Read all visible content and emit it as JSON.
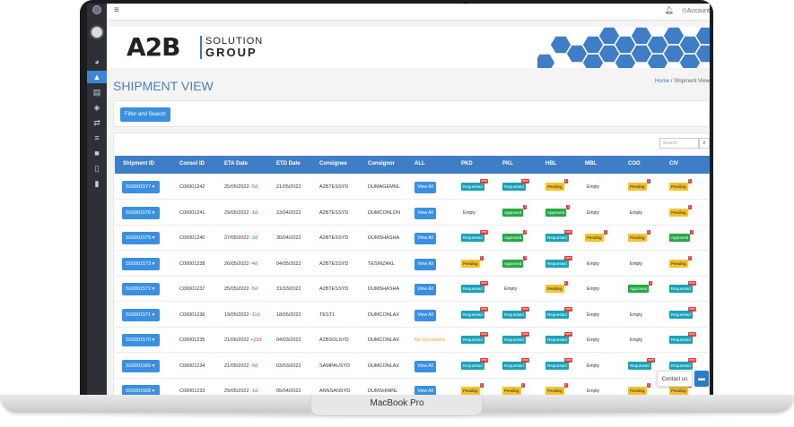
{
  "device_label": "MacBook Pro",
  "topbar": {
    "account": "Account"
  },
  "brand": {
    "main": "A2B",
    "line1": "SOLUTION",
    "line2": "GROUP"
  },
  "page": {
    "title": "SHIPMENT VIEW",
    "breadcrumb_home": "Home",
    "breadcrumb_sep": "/",
    "breadcrumb_current": "Shipment View"
  },
  "filter": {
    "button": "Filter and Search"
  },
  "search": {
    "placeholder": "Search"
  },
  "columns": [
    "Shipment ID",
    "Consol ID",
    "ETA Date",
    "ETD Date",
    "Consignee",
    "Consignor",
    "ALL",
    "PKD",
    "PKL",
    "HBL",
    "MBL",
    "COO",
    "CIV"
  ],
  "view_all_label": "View All",
  "rows": [
    {
      "sid": "S00001577",
      "consol": "C00001242",
      "eta": "25/05/2022",
      "eta_delta": "-5d",
      "etd": "21/05/2022",
      "consignee": "A2BTESSYD",
      "consignor": "DUMAGEMNL",
      "all": "view",
      "docs": [
        [
          "Requested",
          "new"
        ],
        [
          "Requested",
          "new"
        ],
        [
          "Pending",
          "1"
        ],
        [
          "Empty",
          ""
        ],
        [
          "Pending",
          "1"
        ],
        [
          "Pending",
          "1"
        ]
      ]
    },
    {
      "sid": "S00001576",
      "consol": "C00001241",
      "eta": "29/05/2022",
      "eta_delta": "-1d",
      "etd": "23/04/2022",
      "consignee": "A2BTESSYD",
      "consignor": "DUMCONLON",
      "all": "view",
      "docs": [
        [
          "Empty",
          ""
        ],
        [
          "Approved",
          "1"
        ],
        [
          "Approved",
          "1"
        ],
        [
          "Empty",
          ""
        ],
        [
          "Empty",
          ""
        ],
        [
          "Pending",
          "1"
        ]
      ]
    },
    {
      "sid": "S00001575",
      "consol": "C00001240",
      "eta": "27/05/2022",
      "eta_delta": "-3d",
      "etd": "30/04/2022",
      "consignee": "A2BTESSYD",
      "consignor": "DUMSHASHA",
      "all": "view",
      "docs": [
        [
          "Requested",
          "new"
        ],
        [
          "Approved",
          "1"
        ],
        [
          "Requested",
          "new"
        ],
        [
          "Pending",
          "1"
        ],
        [
          "Pending",
          "1"
        ],
        [
          "Approved",
          "1"
        ]
      ]
    },
    {
      "sid": "S00001573",
      "consol": "C00001238",
      "eta": "26/05/2022",
      "eta_delta": "-4d",
      "etd": "04/05/2022",
      "consignee": "A2BTESSYD",
      "consignor": "TESINZAKL",
      "all": "view",
      "docs": [
        [
          "Pending",
          "1"
        ],
        [
          "Approved",
          "1"
        ],
        [
          "Requested",
          "new"
        ],
        [
          "Empty",
          ""
        ],
        [
          "Empty",
          ""
        ],
        [
          "Pending",
          "1"
        ]
      ]
    },
    {
      "sid": "S00001572",
      "consol": "C00001237",
      "eta": "25/05/2022",
      "eta_delta": "-5d",
      "etd": "31/03/2022",
      "consignee": "A2BTESSYD",
      "consignor": "DUMSHASHA",
      "all": "view",
      "docs": [
        [
          "Requested",
          "new"
        ],
        [
          "Empty",
          ""
        ],
        [
          "Pending",
          "1"
        ],
        [
          "Empty",
          ""
        ],
        [
          "Approved",
          "1"
        ],
        [
          "Requested",
          "new"
        ]
      ]
    },
    {
      "sid": "S00001571",
      "consol": "C00001236",
      "eta": "19/05/2022",
      "eta_delta": "-11d",
      "etd": "18/05/2022",
      "consignee": "TEST1",
      "consignor": "DUMCONLAX",
      "all": "view",
      "docs": [
        [
          "Requested",
          "new"
        ],
        [
          "Requested",
          "new"
        ],
        [
          "Requested",
          "new"
        ],
        [
          "Empty",
          ""
        ],
        [
          "Empty",
          ""
        ],
        [
          "Requested",
          "new"
        ]
      ]
    },
    {
      "sid": "S00001570",
      "consol": "C00001235",
      "eta": "21/06/2022",
      "eta_delta": "+22d",
      "etd": "04/03/2022",
      "consignee": "A2BSOLSYD",
      "consignor": "DUMCONLAX",
      "all": "No Document",
      "docs": [
        [
          "Requested",
          "new"
        ],
        [
          "Requested",
          "new"
        ],
        [
          "Requested",
          "new"
        ],
        [
          "Empty",
          ""
        ],
        [
          "Empty",
          ""
        ],
        [
          "Requested",
          "new"
        ]
      ]
    },
    {
      "sid": "S00001569",
      "consol": "C00001234",
      "eta": "21/05/2022",
      "eta_delta": "-9d",
      "etd": "03/03/2022",
      "consignee": "SAMPAUSYD",
      "consignor": "DUMCONLAX",
      "all": "view",
      "docs": [
        [
          "Requested",
          "new"
        ],
        [
          "Requested",
          "new"
        ],
        [
          "Requested",
          "new"
        ],
        [
          "Empty",
          ""
        ],
        [
          "Requested",
          "new"
        ],
        [
          "Requested",
          "new"
        ]
      ]
    },
    {
      "sid": "S00001568",
      "consol": "C00001233",
      "eta": "29/05/2022",
      "eta_delta": "-1d",
      "etd": "05/04/2022",
      "consignee": "ANNSANSYD",
      "consignor": "DUMSHIMNL",
      "all": "view",
      "docs": [
        [
          "Pending",
          "1"
        ],
        [
          "Pending",
          "1"
        ],
        [
          "Pending",
          "1"
        ],
        [
          "Empty",
          ""
        ],
        [
          "Pending",
          "1"
        ],
        [
          "Pending",
          "1"
        ]
      ]
    }
  ],
  "contact": {
    "label": "Contact us"
  },
  "colors": {
    "primary": "#3b8fe0",
    "header": "#3f7ec7",
    "requested": "#1aa3b8",
    "approved": "#27a844",
    "pending": "#f2c231",
    "sidebar": "#2d3137"
  }
}
